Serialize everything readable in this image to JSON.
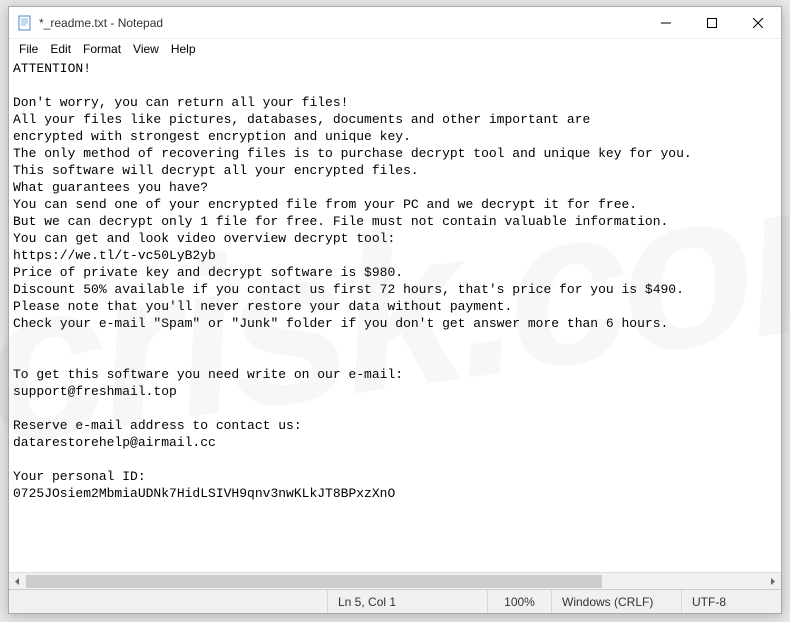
{
  "window": {
    "title": "*_readme.txt - Notepad"
  },
  "menu": {
    "file": "File",
    "edit": "Edit",
    "format": "Format",
    "view": "View",
    "help": "Help"
  },
  "content": "ATTENTION!\n\nDon't worry, you can return all your files!\nAll your files like pictures, databases, documents and other important are\nencrypted with strongest encryption and unique key.\nThe only method of recovering files is to purchase decrypt tool and unique key for you.\nThis software will decrypt all your encrypted files.\nWhat guarantees you have?\nYou can send one of your encrypted file from your PC and we decrypt it for free.\nBut we can decrypt only 1 file for free. File must not contain valuable information.\nYou can get and look video overview decrypt tool:\nhttps://we.tl/t-vc50LyB2yb\nPrice of private key and decrypt software is $980.\nDiscount 50% available if you contact us first 72 hours, that's price for you is $490.\nPlease note that you'll never restore your data without payment.\nCheck your e-mail \"Spam\" or \"Junk\" folder if you don't get answer more than 6 hours.\n\n\nTo get this software you need write on our e-mail:\nsupport@freshmail.top\n\nReserve e-mail address to contact us:\ndatarestorehelp@airmail.cc\n\nYour personal ID:\n0725JOsiem2MbmiaUDNk7HidLSIVH9qnv3nwKLkJT8BPxzXnO\n",
  "status": {
    "position": "Ln 5, Col 1",
    "zoom": "100%",
    "line_ending": "Windows (CRLF)",
    "encoding": "UTF-8"
  },
  "watermark": "pcrisk.com"
}
